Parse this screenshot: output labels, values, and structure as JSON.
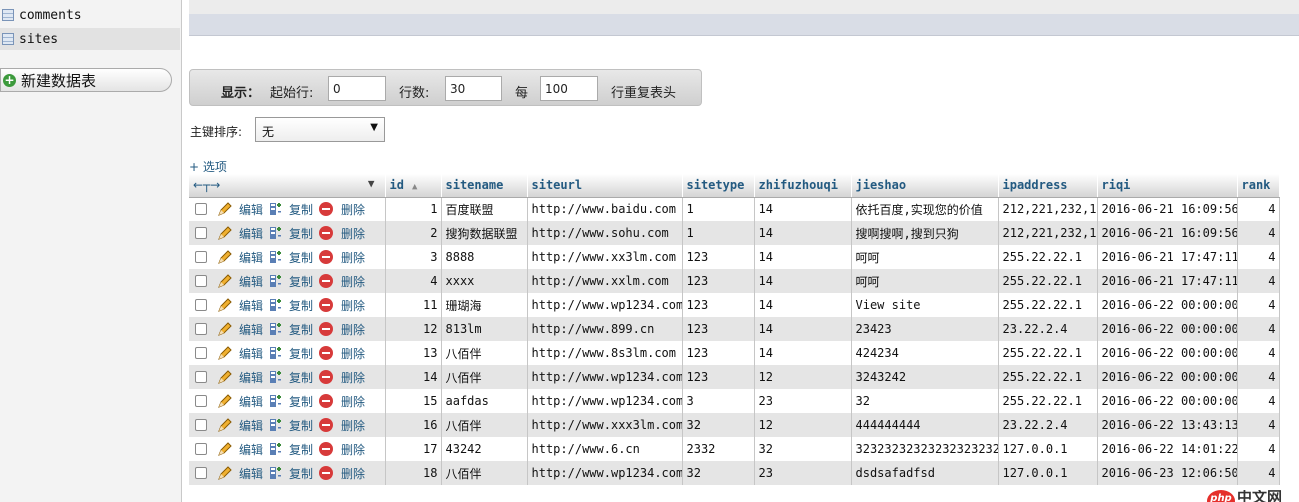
{
  "sidebar": {
    "tables": [
      "comments",
      "sites"
    ],
    "new_db_label": "新建数据表"
  },
  "display": {
    "label": "显示：",
    "start_label": "起始行:",
    "start_value": "0",
    "rows_label": "行数:",
    "rows_value": "30",
    "every_label": "每",
    "every_value": "100",
    "repeat_label": "行重复表头"
  },
  "sort": {
    "label": "主键排序:",
    "value": "无"
  },
  "options_label": "+ 选项",
  "actions": {
    "edit": "编辑",
    "copy": "复制",
    "delete": "删除"
  },
  "columns": [
    "id",
    "sitename",
    "siteurl",
    "sitetype",
    "zhifuzhouqi",
    "jieshao",
    "ipaddress",
    "riqi",
    "rank"
  ],
  "rows": [
    [
      "1",
      "百度联盟",
      "http://www.baidu.com",
      "1",
      "14",
      "依托百度,实现您的价值",
      "212,221,232,1",
      "2016-06-21 16:09:56",
      "4"
    ],
    [
      "2",
      "搜狗数据联盟",
      "http://www.sohu.com",
      "1",
      "14",
      "搜啊搜啊,搜到只狗",
      "212,221,232,1",
      "2016-06-21 16:09:56",
      "4"
    ],
    [
      "3",
      "8888",
      "http://www.xx3lm.com",
      "123",
      "14",
      "呵呵",
      "255.22.22.1",
      "2016-06-21 17:47:11",
      "4"
    ],
    [
      "4",
      "xxxx",
      "http://www.xxlm.com",
      "123",
      "14",
      "呵呵",
      "255.22.22.1",
      "2016-06-21 17:47:11",
      "4"
    ],
    [
      "11",
      "珊瑚海",
      "http://www.wp1234.com",
      "123",
      "14",
      "View site",
      "255.22.22.1",
      "2016-06-22 00:00:00",
      "4"
    ],
    [
      "12",
      "813lm",
      "http://www.899.cn",
      "123",
      "14",
      "23423",
      "23.22.2.4",
      "2016-06-22 00:00:00",
      "4"
    ],
    [
      "13",
      "八佰伴",
      "http://www.8s3lm.com",
      "123",
      "14",
      "424234",
      "255.22.22.1",
      "2016-06-22 00:00:00",
      "4"
    ],
    [
      "14",
      "八佰伴",
      "http://www.wp1234.com",
      "123",
      "12",
      "3243242",
      "255.22.22.1",
      "2016-06-22 00:00:00",
      "4"
    ],
    [
      "15",
      "aafdas",
      "http://www.wp1234.com",
      "3",
      "23",
      "32",
      "255.22.22.1",
      "2016-06-22 00:00:00",
      "4"
    ],
    [
      "16",
      "八佰伴",
      "http://www.xxx3lm.com",
      "32",
      "12",
      "444444444",
      "23.22.2.4",
      "2016-06-22 13:43:13",
      "4"
    ],
    [
      "17",
      "43242",
      "http://www.6.cn",
      "2332",
      "32",
      "32323232323232323232",
      "127.0.0.1",
      "2016-06-22 14:01:22",
      "4"
    ],
    [
      "18",
      "八佰伴",
      "http://www.wp1234.com",
      "32",
      "23",
      "dsdsafadfsd",
      "127.0.0.1",
      "2016-06-23 12:06:50",
      "4"
    ]
  ],
  "watermark": {
    "logo": "php",
    "text": "中文网"
  },
  "colors": {
    "link": "#235a81",
    "row_alt": "#e5e5e5",
    "delete": "#d73a3a"
  }
}
